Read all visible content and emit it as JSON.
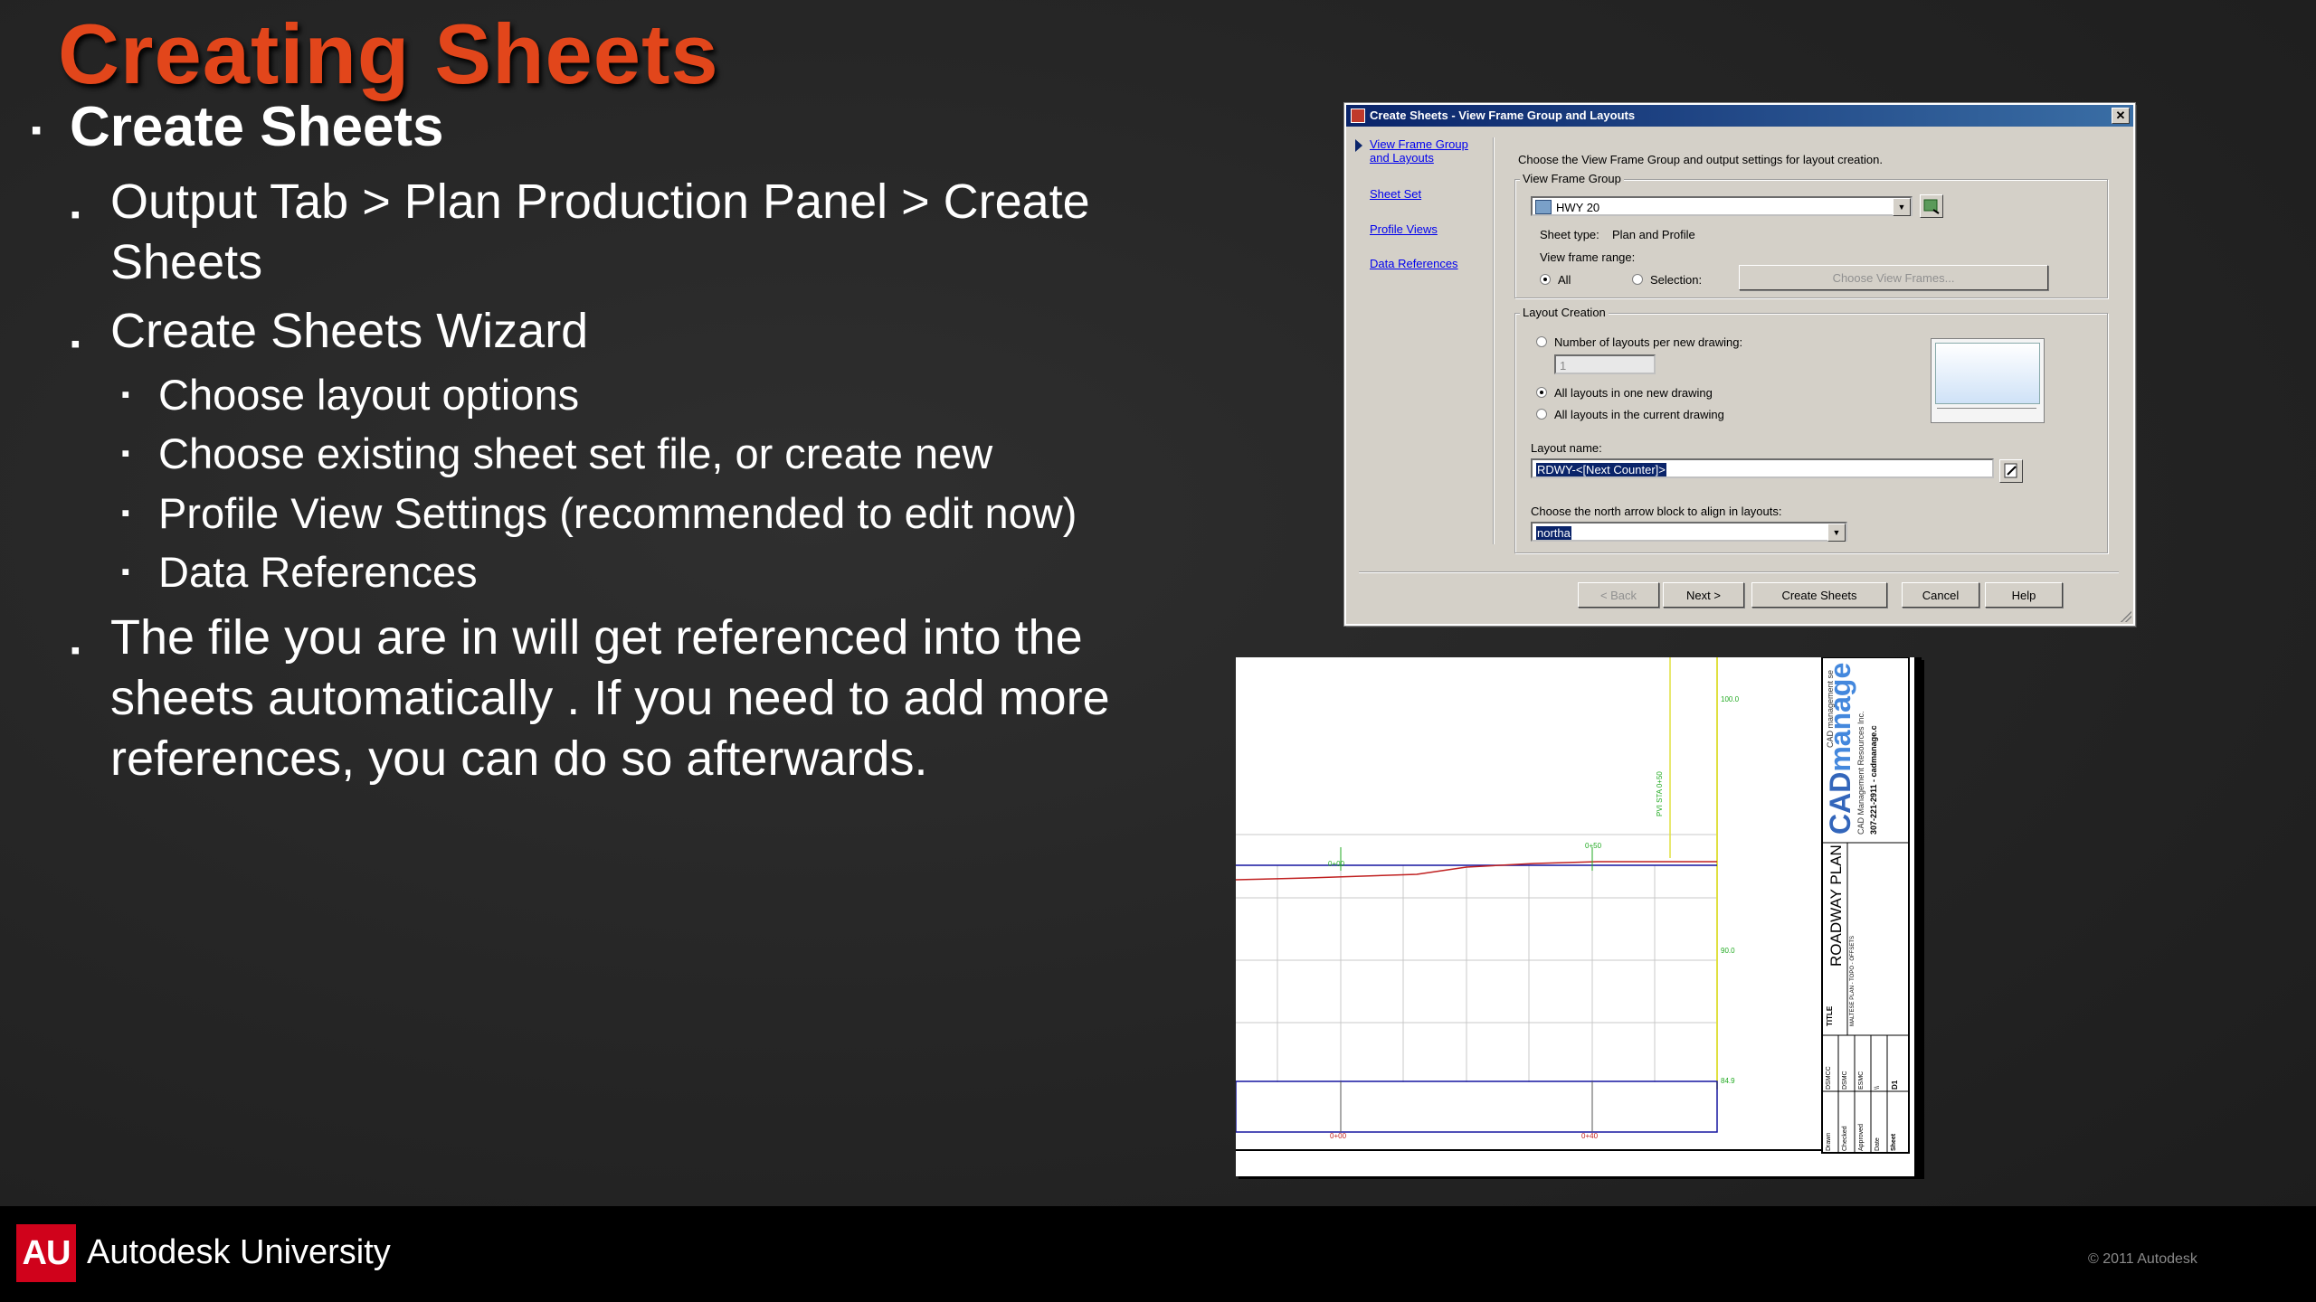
{
  "slide": {
    "title": "Creating Sheets",
    "bullet_glyph": "▪",
    "items": {
      "b1": "Create Sheets",
      "b1_1": "Output Tab > Plan Production Panel > Create Sheets",
      "b1_2": "Create Sheets Wizard",
      "b1_2_1": "Choose layout options",
      "b1_2_2": "Choose existing sheet set file, or create new",
      "b1_2_3": "Profile View Settings (recommended to edit now)",
      "b1_2_4": "Data References",
      "b1_3": "The file you are in will get referenced into the sheets automatically .  If you need to add more references, you can do so afterwards."
    }
  },
  "dialog": {
    "title": "Create Sheets - View Frame Group and Layouts",
    "close_glyph": "✕",
    "nav": {
      "view_frame": "View Frame Group and Layouts",
      "sheet_set": "Sheet Set",
      "profile_views": "Profile Views",
      "data_references": "Data References"
    },
    "instruction": "Choose the View Frame Group and output settings for layout creation.",
    "view_frame_group": {
      "label": "View Frame Group",
      "value": "HWY 20",
      "sheet_type_label": "Sheet type:",
      "sheet_type_value": "Plan and Profile",
      "range_label": "View frame range:",
      "all": "All",
      "selection": "Selection:",
      "choose_frames": "Choose View Frames..."
    },
    "layout_creation": {
      "label": "Layout Creation",
      "num_layouts": "Number of layouts per new drawing:",
      "num_value": "1",
      "one_new": "All layouts in one new drawing",
      "current": "All layouts in the current drawing",
      "name_label": "Layout name:",
      "name_value": "RDWY-<[Next Counter]>",
      "north_label": "Choose the north arrow block to align in layouts:",
      "north_value": "northa"
    },
    "buttons": {
      "back": "< Back",
      "next": "Next >",
      "create": "Create Sheets",
      "cancel": "Cancel",
      "help": "Help"
    }
  },
  "sheet": {
    "elev_labels": [
      "100.0",
      "90.0",
      "84.9"
    ],
    "station_labels": [
      "0+00",
      "0+40"
    ],
    "sta_top": [
      "0+00",
      "0+50"
    ],
    "logo_main": "CAD",
    "logo_accent": "manage",
    "logo_small_1": "CAD management se",
    "logo_small_2": "CAD Management Resources Inc.",
    "logo_phone": "307-221-2911 - cadmanage.c",
    "sheet_title": "ROADWAY PLAN",
    "title_label": "TITLE",
    "project": "MALTESE PLAN - TOPO - OFFSETS",
    "pvi_label": "PVI STA 0+50",
    "col_labels": [
      "Drawn",
      "Checked",
      "Approved",
      "Date"
    ],
    "col_values": [
      "DSMCC",
      "DSMC",
      "ESMC",
      "\\\\"
    ],
    "sheet_no_label": "Sheet",
    "sheet_no": "D1",
    "colors": {
      "green": "#22aa22",
      "blue": "#1515a0",
      "red": "#c02020",
      "yellow": "#e0e040"
    }
  },
  "footer": {
    "au_badge": "AU",
    "brand": "Autodesk University",
    "copyright": "© 2011 Autodesk"
  }
}
